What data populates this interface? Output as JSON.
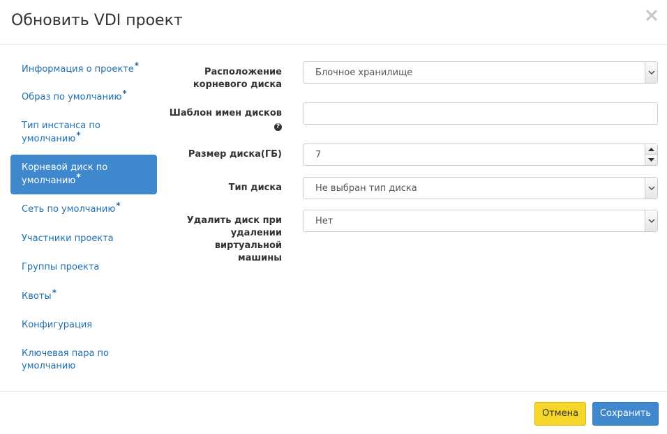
{
  "dialog": {
    "title": "Обновить VDI проект",
    "close_icon": "close-icon"
  },
  "sidebar": {
    "items": [
      {
        "line1": "Информация о проекте",
        "line2": "",
        "required": true,
        "active": false
      },
      {
        "line1": "Образ по умолчанию",
        "line2": "",
        "required": true,
        "active": false
      },
      {
        "line1": "Тип инстанса по",
        "line2": "умолчанию",
        "required": true,
        "active": false
      },
      {
        "line1": "Корневой диск по",
        "line2": "умолчанию",
        "required": true,
        "active": true
      },
      {
        "line1": "Сеть по умолчанию",
        "line2": "",
        "required": true,
        "active": false
      },
      {
        "line1": "Участники проекта",
        "line2": "",
        "required": false,
        "active": false
      },
      {
        "line1": "Группы проекта",
        "line2": "",
        "required": false,
        "active": false
      },
      {
        "line1": "Квоты",
        "line2": "",
        "required": true,
        "active": false
      },
      {
        "line1": "Конфигурация",
        "line2": "",
        "required": false,
        "active": false
      },
      {
        "line1": "Ключевая пара по",
        "line2": "умолчанию",
        "required": false,
        "active": false
      }
    ],
    "required_mark": "*"
  },
  "form": {
    "root_disk_location": {
      "label_line1": "Расположение",
      "label_line2": "корневого диска",
      "value": "Блочное хранилище"
    },
    "disk_name_template": {
      "label": "Шаблон имен дисков",
      "value": "",
      "help_icon": "question-circle-icon"
    },
    "disk_size": {
      "label": "Размер диска(ГБ)",
      "value": "7"
    },
    "disk_type": {
      "label": "Тип диска",
      "value": "Не выбран тип диска"
    },
    "delete_disk": {
      "label_line1": "Удалить диск при",
      "label_line2": "удалении",
      "label_line3": "виртуальной",
      "label_line4": "машины",
      "value": "Нет"
    }
  },
  "footer": {
    "cancel_label": "Отмена",
    "save_label": "Сохранить"
  },
  "colors": {
    "accent": "#3f88ce",
    "cancel": "#f7d62b",
    "link": "#1f6fb2"
  }
}
